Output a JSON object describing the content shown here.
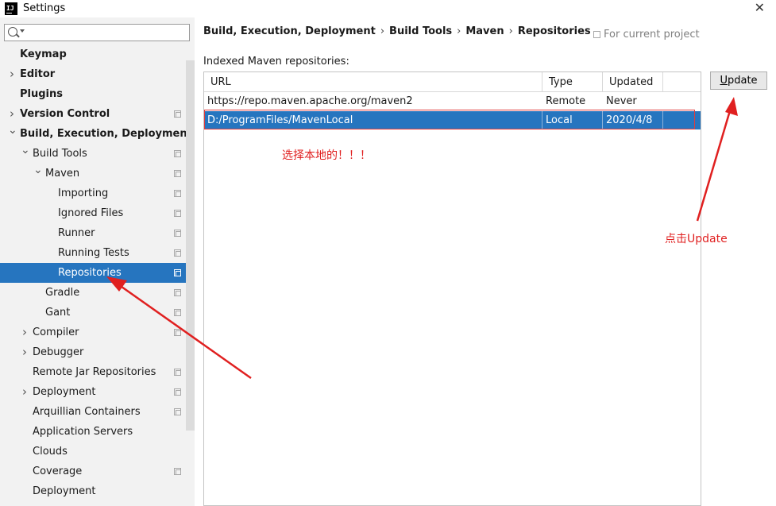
{
  "window": {
    "title": "Settings",
    "logo_text": "IJ"
  },
  "search": {
    "placeholder": "",
    "value": ""
  },
  "sidebar": {
    "items": [
      {
        "label": "Keymap",
        "bold": true,
        "indent": 0,
        "chevron": "",
        "proj": false,
        "selected": false
      },
      {
        "label": "Editor",
        "bold": true,
        "indent": 0,
        "chevron": "right",
        "proj": false,
        "selected": false
      },
      {
        "label": "Plugins",
        "bold": true,
        "indent": 0,
        "chevron": "",
        "proj": false,
        "selected": false
      },
      {
        "label": "Version Control",
        "bold": true,
        "indent": 0,
        "chevron": "right",
        "proj": true,
        "selected": false
      },
      {
        "label": "Build, Execution, Deployment",
        "bold": true,
        "indent": 0,
        "chevron": "down",
        "proj": false,
        "selected": false
      },
      {
        "label": "Build Tools",
        "bold": false,
        "indent": 1,
        "chevron": "down",
        "proj": true,
        "selected": false
      },
      {
        "label": "Maven",
        "bold": false,
        "indent": 2,
        "chevron": "down",
        "proj": true,
        "selected": false
      },
      {
        "label": "Importing",
        "bold": false,
        "indent": 3,
        "chevron": "",
        "proj": true,
        "selected": false
      },
      {
        "label": "Ignored Files",
        "bold": false,
        "indent": 3,
        "chevron": "",
        "proj": true,
        "selected": false
      },
      {
        "label": "Runner",
        "bold": false,
        "indent": 3,
        "chevron": "",
        "proj": true,
        "selected": false
      },
      {
        "label": "Running Tests",
        "bold": false,
        "indent": 3,
        "chevron": "",
        "proj": true,
        "selected": false
      },
      {
        "label": "Repositories",
        "bold": false,
        "indent": 3,
        "chevron": "",
        "proj": true,
        "selected": true
      },
      {
        "label": "Gradle",
        "bold": false,
        "indent": 2,
        "chevron": "",
        "proj": true,
        "selected": false
      },
      {
        "label": "Gant",
        "bold": false,
        "indent": 2,
        "chevron": "",
        "proj": true,
        "selected": false
      },
      {
        "label": "Compiler",
        "bold": false,
        "indent": 1,
        "chevron": "right",
        "proj": true,
        "selected": false
      },
      {
        "label": "Debugger",
        "bold": false,
        "indent": 1,
        "chevron": "right",
        "proj": false,
        "selected": false
      },
      {
        "label": "Remote Jar Repositories",
        "bold": false,
        "indent": 1,
        "chevron": "",
        "proj": true,
        "selected": false
      },
      {
        "label": "Deployment",
        "bold": false,
        "indent": 1,
        "chevron": "right",
        "proj": true,
        "selected": false
      },
      {
        "label": "Arquillian Containers",
        "bold": false,
        "indent": 1,
        "chevron": "",
        "proj": true,
        "selected": false
      },
      {
        "label": "Application Servers",
        "bold": false,
        "indent": 1,
        "chevron": "",
        "proj": false,
        "selected": false
      },
      {
        "label": "Clouds",
        "bold": false,
        "indent": 1,
        "chevron": "",
        "proj": false,
        "selected": false
      },
      {
        "label": "Coverage",
        "bold": false,
        "indent": 1,
        "chevron": "",
        "proj": true,
        "selected": false
      },
      {
        "label": "Deployment",
        "bold": false,
        "indent": 1,
        "chevron": "",
        "proj": false,
        "selected": false
      }
    ]
  },
  "breadcrumb": [
    "Build, Execution, Deployment",
    "Build Tools",
    "Maven",
    "Repositories"
  ],
  "breadcrumb_separator": "›",
  "for_project": "For current project",
  "section_label": "Indexed Maven repositories:",
  "table": {
    "columns": [
      "URL",
      "Type",
      "Updated"
    ],
    "rows": [
      {
        "url": "https://repo.maven.apache.org/maven2",
        "type": "Remote",
        "updated": "Never",
        "selected": false
      },
      {
        "url": "D:/ProgramFiles/MavenLocal",
        "type": "Local",
        "updated": "2020/4/8",
        "selected": true
      }
    ]
  },
  "update_button": {
    "mnemonic": "U",
    "rest": "pdate"
  },
  "annotations": {
    "select_local": "选择本地的！！！",
    "click_update": "点击Update"
  },
  "colors": {
    "selection": "#2675bf",
    "annotation": "#e02020"
  },
  "icons": {
    "close": "close-icon",
    "search": "search-icon",
    "project": "project-scope-icon"
  }
}
